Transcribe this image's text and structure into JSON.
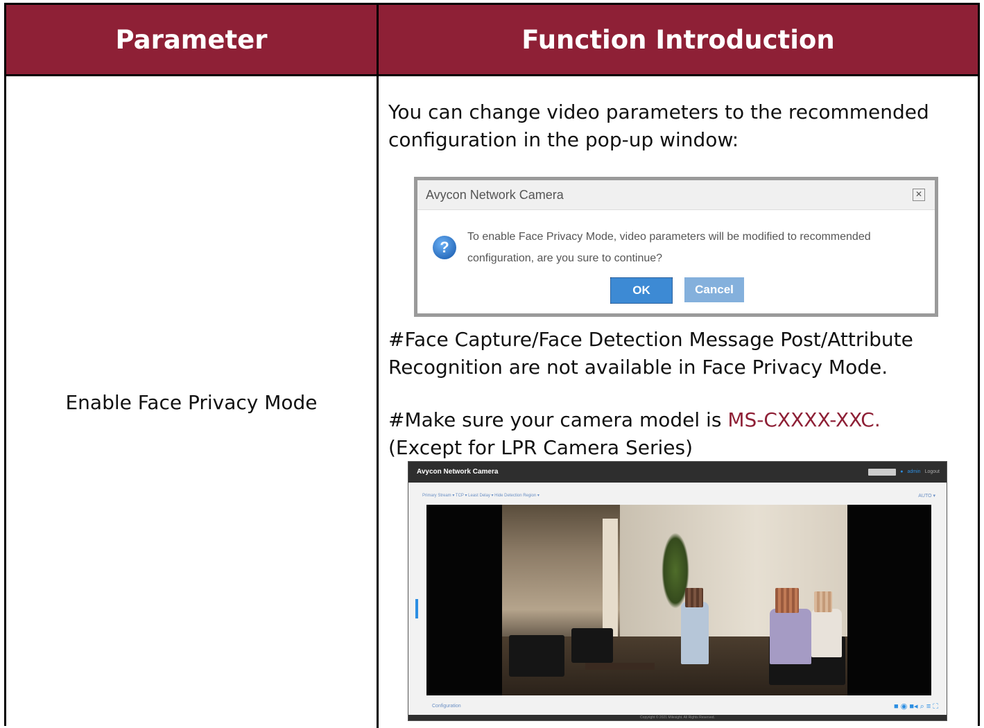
{
  "header": {
    "parameter": "Parameter",
    "function": "Function Introduction"
  },
  "row": {
    "parameter": "Enable Face Privacy Mode",
    "intro": "You can change video parameters to the recommended configuration in the pop-up window:",
    "note1": "#Face Capture/Face Detection Message Post/Attribute Recognition are not available in Face Privacy Mode.",
    "note2_prefix": "#Make sure your camera model is ",
    "note2_model": "MS-CXXXX-XXC.",
    "note2_suffix": "(Except for LPR Camera Series)"
  },
  "dialog": {
    "title": "Avycon Network Camera",
    "close": "✕",
    "icon": "?",
    "message": "To enable Face Privacy Mode, video parameters will be modified to recommended configuration, are you sure to continue?",
    "ok": "OK",
    "cancel": "Cancel"
  },
  "camera_ui": {
    "title": "Avycon Network Camera",
    "user": "admin",
    "logout": "Logout",
    "toolbar": "Primary Stream  ▾   TCP  ▾   Least Delay  ▾   Hide Detection Region  ▾",
    "toolbar_right": "AUTO ▾",
    "configuration": "Configuration",
    "tools": "■ ◉ ■◂ ⌕ ≡ ⛶",
    "footer": "Copyright © 2021 Milesight. All Rights Reserved."
  },
  "colors": {
    "header_bg": "#8e2036",
    "accent_red": "#8e2036",
    "dialog_ok": "#3d8ad4",
    "dialog_cancel": "#84b0dc"
  }
}
